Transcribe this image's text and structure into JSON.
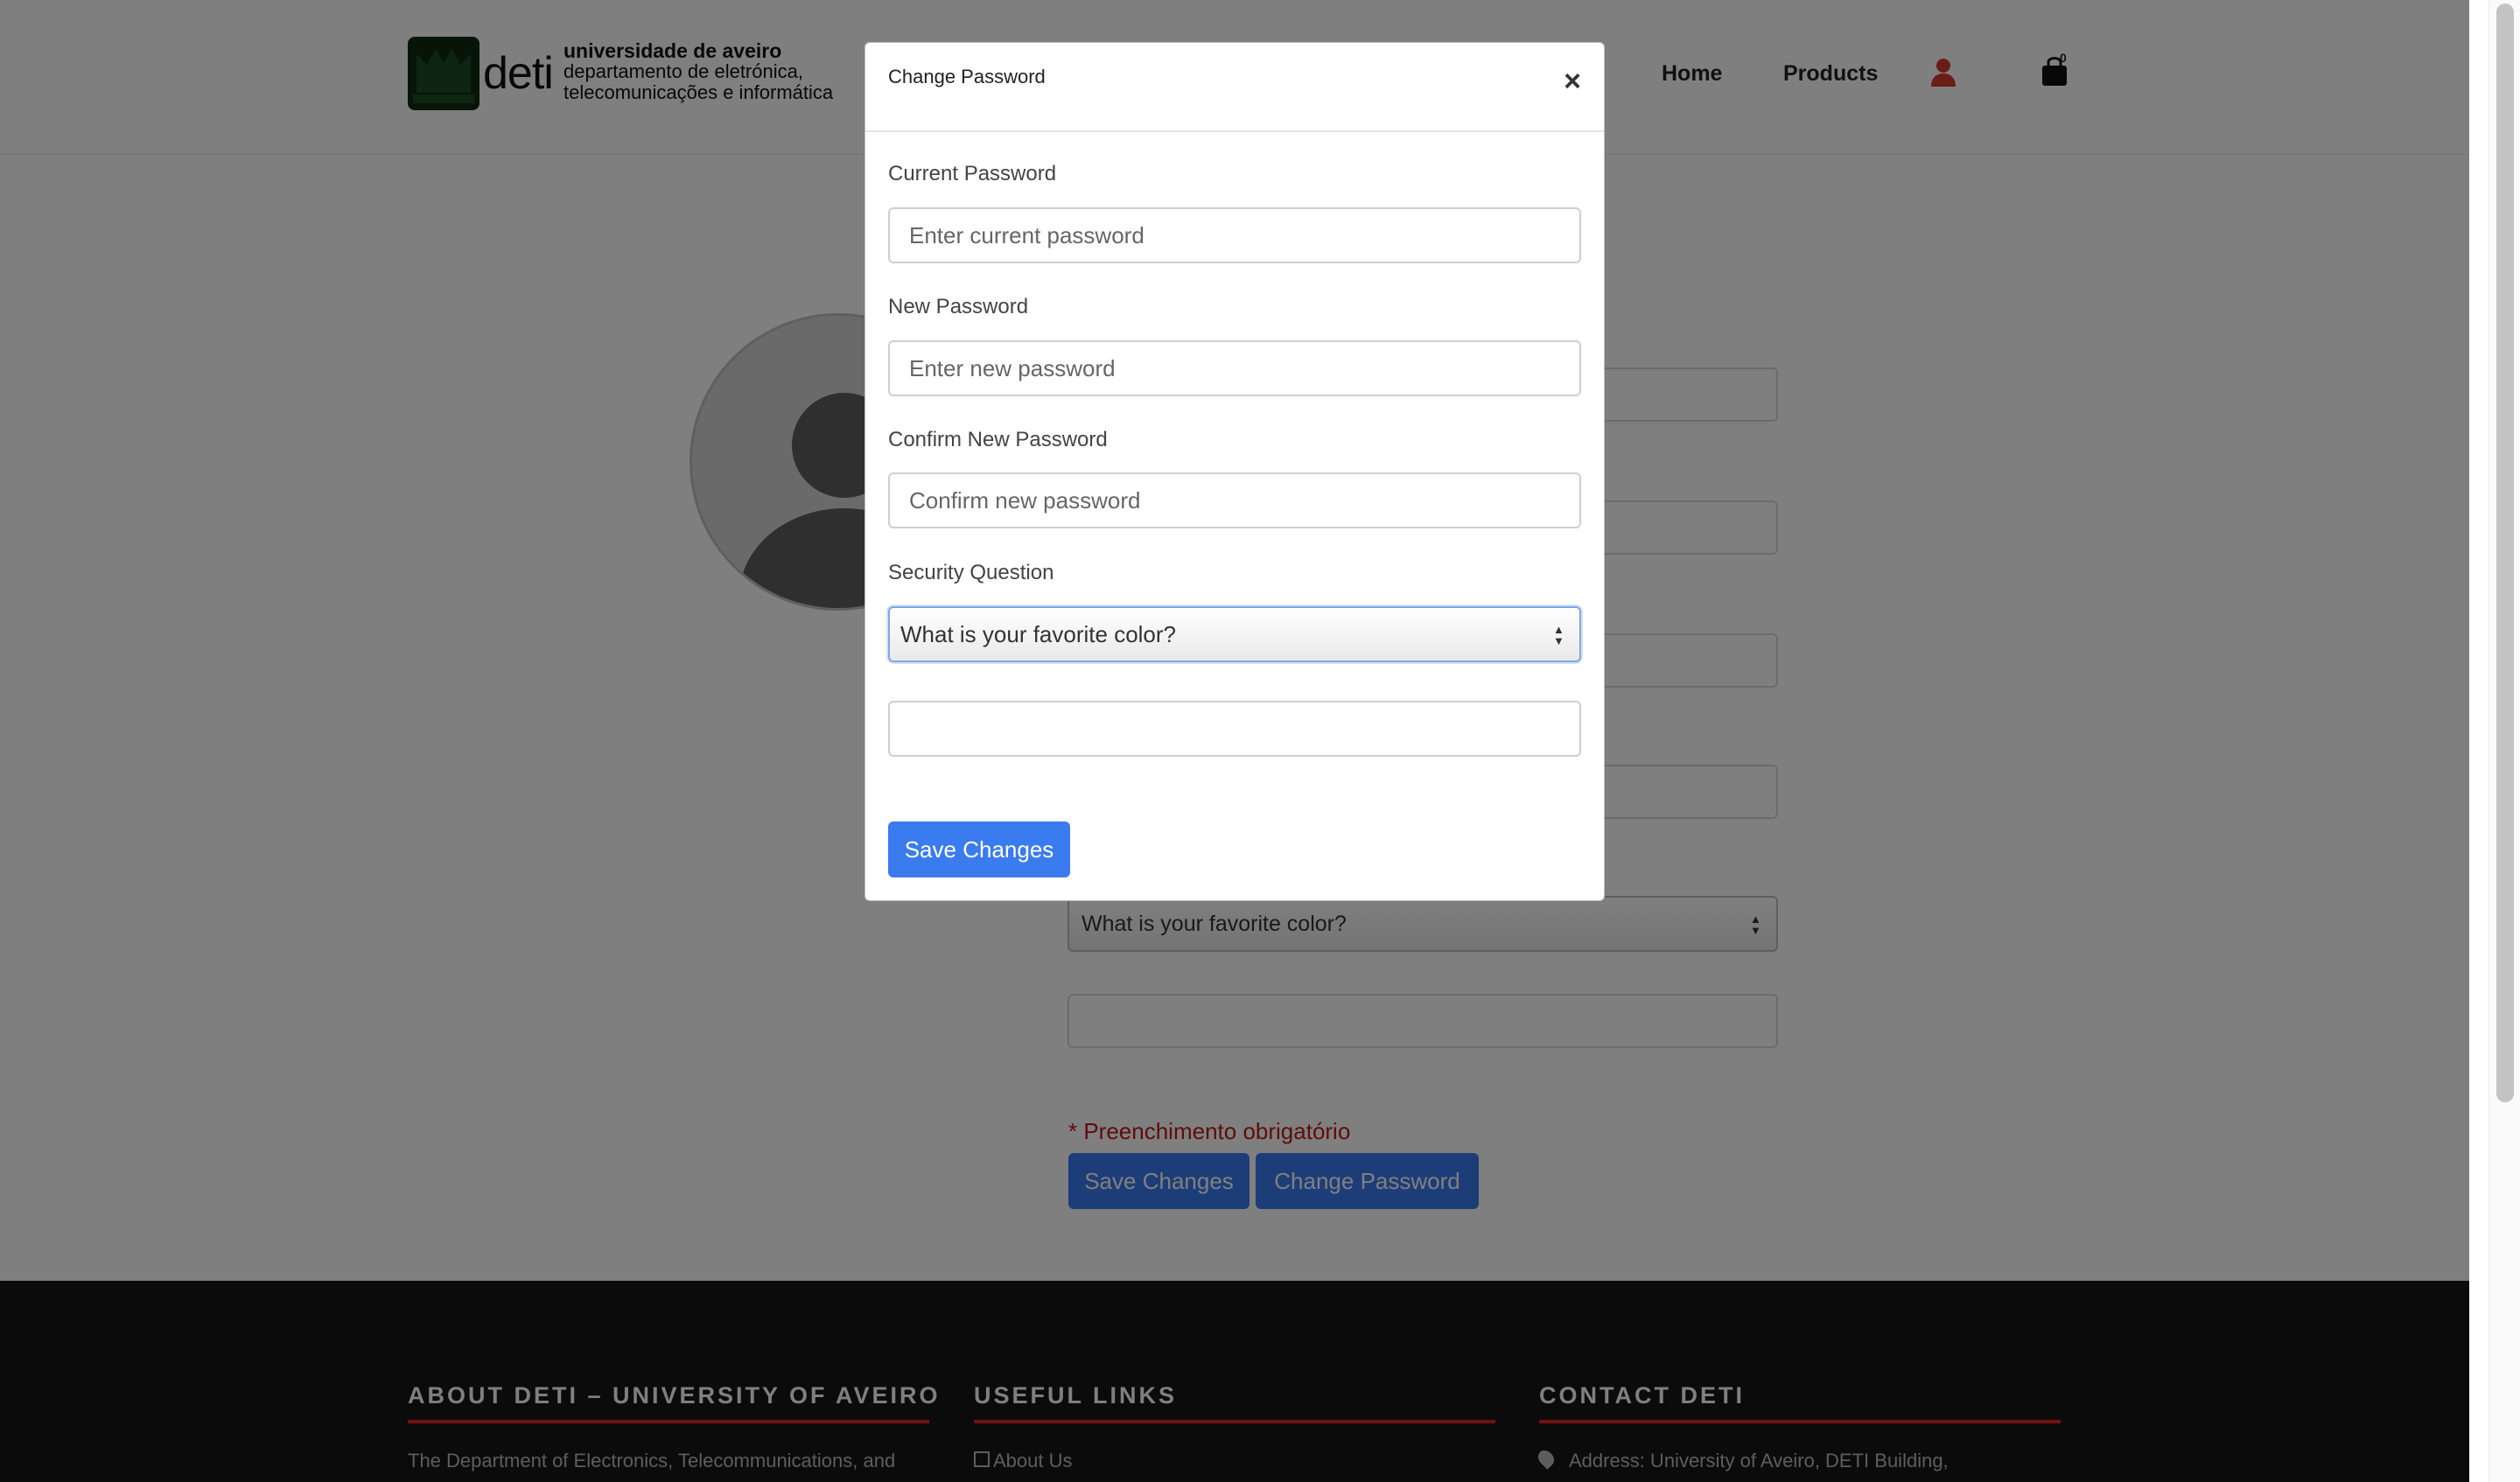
{
  "brand": {
    "name": "deti",
    "line1": "universidade de aveiro",
    "line2": "departamento de eletrónica,",
    "line3": "telecomunicações e informática"
  },
  "nav": {
    "home": "Home",
    "products": "Products",
    "cart_count": "0"
  },
  "profile_form": {
    "security_question": "What is your favorite color?",
    "required_note": "* Preenchimento obrigatório",
    "save_label": "Save Changes",
    "change_password_label": "Change Password"
  },
  "modal": {
    "title": "Change Password",
    "close": "×",
    "current_label": "Current Password",
    "current_placeholder": "Enter current password",
    "new_label": "New Password",
    "new_placeholder": "Enter new password",
    "confirm_label": "Confirm New Password",
    "confirm_placeholder": "Confirm new password",
    "security_label": "Security Question",
    "security_value": "What is your favorite color?",
    "answer_value": "",
    "save_label": "Save Changes"
  },
  "footer": {
    "about_title": "ABOUT DETI – UNIVERSITY OF AVEIRO",
    "about_text": "The Department of Electronics, Telecommunications, and",
    "links_title": "USEFUL LINKS",
    "links_first": "About Us",
    "contact_title": "CONTACT DETI",
    "contact_address": "Address: University of Aveiro, DETI Building,"
  },
  "colors": {
    "accent": "#3a7bf0",
    "required": "#c01818",
    "footer_bg": "#161616",
    "footer_rule": "#e02424",
    "user_icon": "#d33a2c"
  }
}
